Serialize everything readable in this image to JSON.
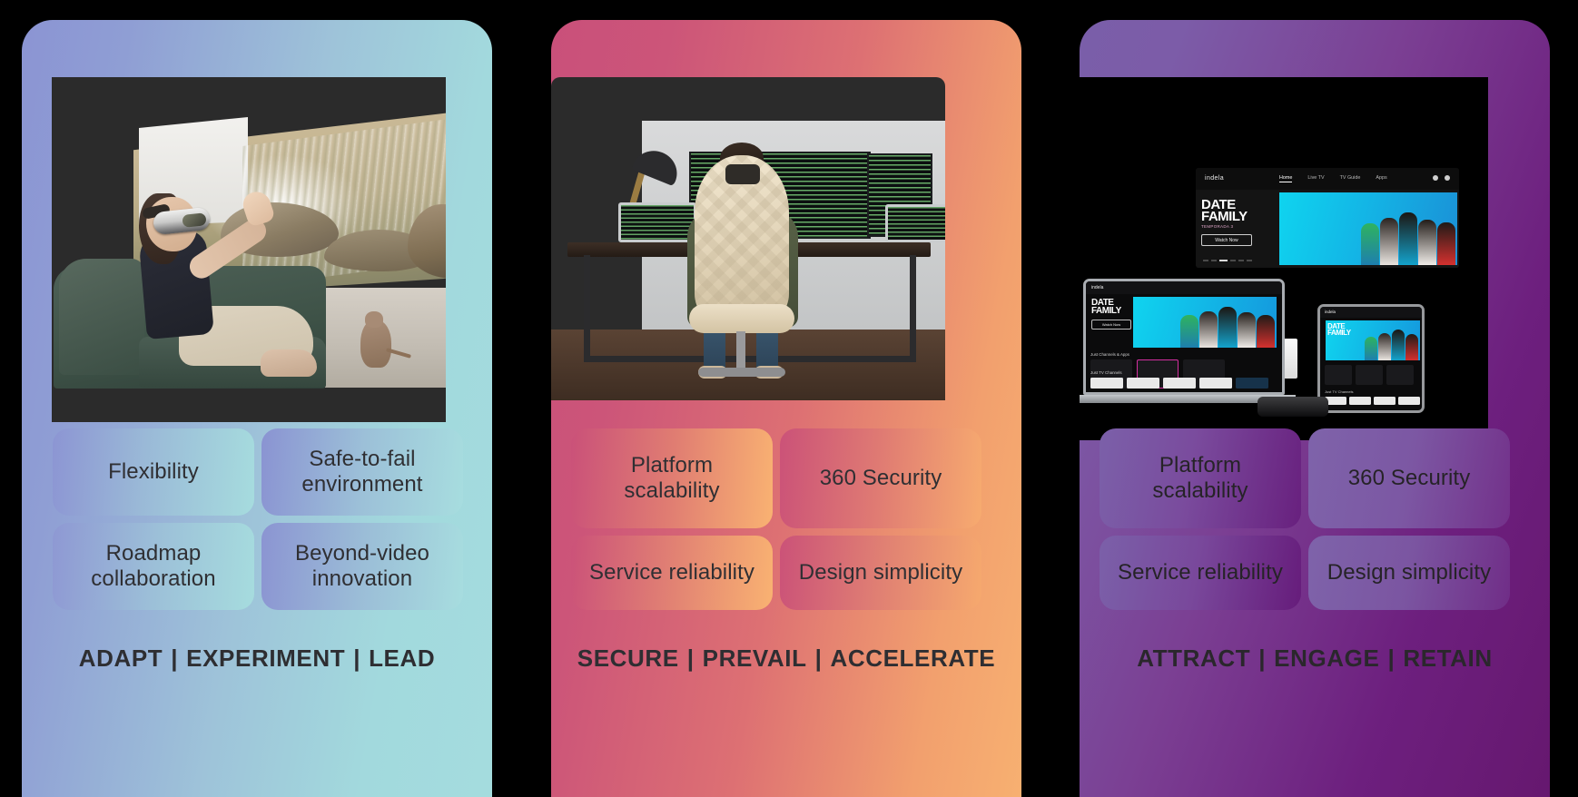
{
  "cards": [
    {
      "id": "adapt",
      "accent_start": "#8b94d3",
      "accent_end": "#a4dcde",
      "image_alt": "Woman wearing VR headset on a sofa with a virtual seaside vista and a cat",
      "tiles": [
        "Flexibility",
        "Safe-to-fail environment",
        "Roadmap collaboration",
        "Beyond-video innovation"
      ],
      "tagline_words": [
        "ADAPT",
        "EXPERIMENT",
        "LEAD"
      ],
      "tagline": "ADAPT  |  EXPERIMENT  |  LEAD"
    },
    {
      "id": "secure",
      "accent_start": "#c9507a",
      "accent_end": "#f7b071",
      "image_alt": "Developer seated in an office chair facing a multi-monitor coding workstation",
      "tiles": [
        "Platform scalability",
        "360 Security",
        "Service reliability",
        "Design simplicity"
      ],
      "tagline_words": [
        "SECURE",
        "PREVAIL",
        "ACCELERATE"
      ],
      "tagline": "SECURE  |  PREVAIL  |  ACCELERATE"
    },
    {
      "id": "attract",
      "accent_start": "#7a5ea9",
      "accent_end": "#66186f",
      "image_alt": "Streaming service shown across TV, laptop, tablet and set-top box devices",
      "tiles": [
        "Platform scalability",
        "360 Security",
        "Service reliability",
        "Design simplicity"
      ],
      "tagline_words": [
        "ATTRACT",
        "ENGAGE",
        "RETAIN"
      ],
      "tagline": "ATTRACT  |  ENGAGE  |  RETAIN"
    }
  ],
  "separator": "|",
  "device_mockup": {
    "brand": "indela",
    "nav": [
      "Home",
      "Live TV",
      "TV Guide",
      "Apps"
    ],
    "active_nav": "Home",
    "poster_line1": "DATE",
    "poster_line2": "FAMILY",
    "poster_sub": "TEMPORADA 3",
    "cta": "Watch Now",
    "section_label": "Just Channels & Apps",
    "section_label2": "Just TV Channels"
  },
  "background": "#000000"
}
